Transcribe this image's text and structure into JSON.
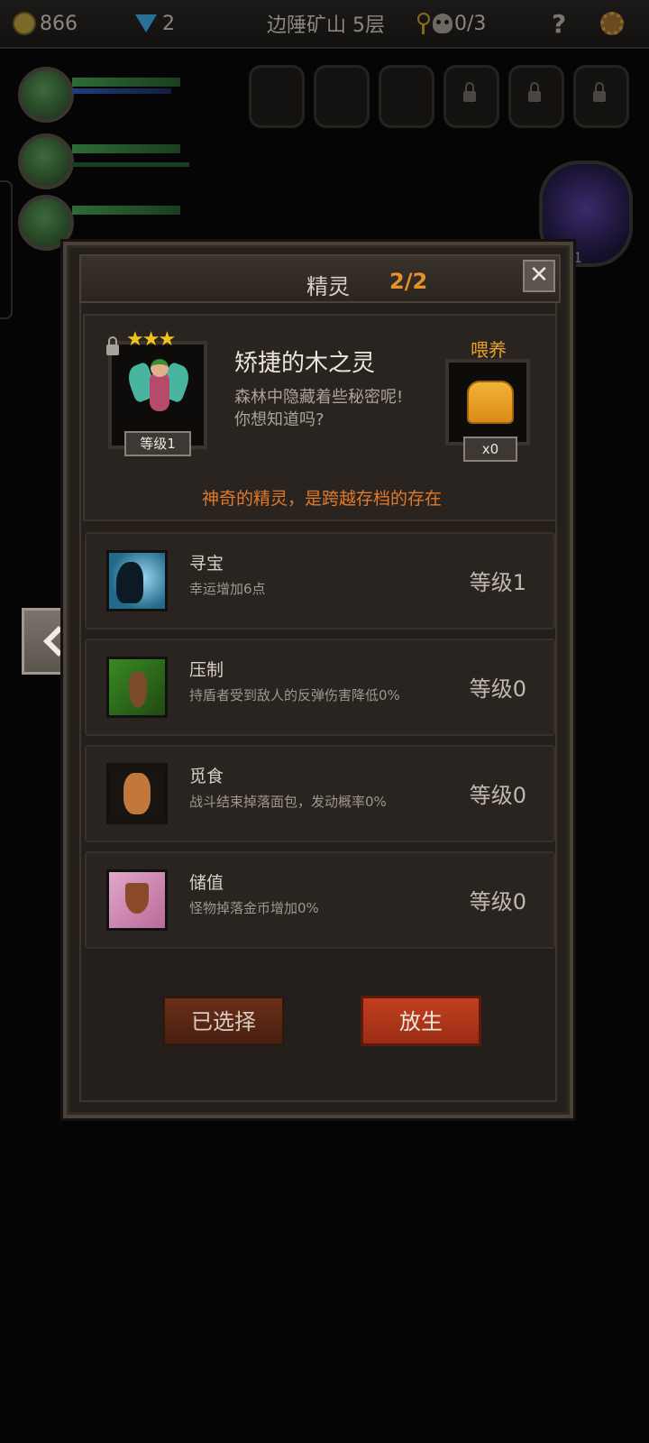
{
  "topbar": {
    "gold": "866",
    "gems": "2",
    "location": "边陲矿山 5层",
    "skulls": "0/3",
    "help": "?"
  },
  "modal": {
    "title": "精灵",
    "count": "2/2",
    "close_glyph": "✕"
  },
  "spirit": {
    "stars": "★★★",
    "level": "等级1",
    "name": "矫捷的木之灵",
    "desc_line1": "森林中隐藏着些秘密呢!",
    "desc_line2": "你想知道吗?",
    "feed_label": "喂养",
    "food_count": "x0",
    "note": "神奇的精灵，是跨越存档的存在"
  },
  "skills": [
    {
      "name": "寻宝",
      "desc": "幸运增加6点",
      "level": "等级1",
      "icon": "treasure-hunt-icon"
    },
    {
      "name": "压制",
      "desc": "持盾者受到敌人的反弹伤害降低0%",
      "level": "等级0",
      "icon": "suppress-icon"
    },
    {
      "name": "觅食",
      "desc": "战斗结束掉落面包，发动概率0%",
      "level": "等级0",
      "icon": "forage-icon"
    },
    {
      "name": "储值",
      "desc": "怪物掉落金币增加0%",
      "level": "等级0",
      "icon": "savings-icon"
    }
  ],
  "buttons": {
    "selected": "已选择",
    "release": "放生"
  },
  "background": {
    "pet_orb_count": "1"
  }
}
